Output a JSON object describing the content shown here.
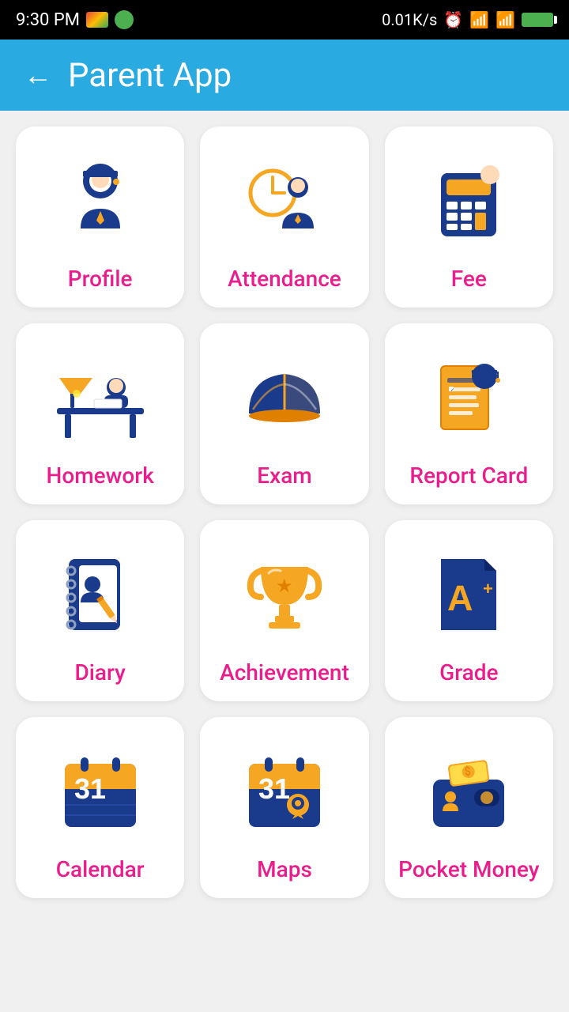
{
  "statusBar": {
    "time": "9:30 PM",
    "network": "0.01K/s"
  },
  "header": {
    "back_label": "←",
    "title": "Parent App"
  },
  "grid": {
    "items": [
      {
        "id": "profile",
        "label": "Profile"
      },
      {
        "id": "attendance",
        "label": "Attendance"
      },
      {
        "id": "fee",
        "label": "Fee"
      },
      {
        "id": "homework",
        "label": "Homework"
      },
      {
        "id": "exam",
        "label": "Exam"
      },
      {
        "id": "report-card",
        "label": "Report Card"
      },
      {
        "id": "diary",
        "label": "Diary"
      },
      {
        "id": "achievement",
        "label": "Achievement"
      },
      {
        "id": "grade",
        "label": "Grade"
      },
      {
        "id": "calendar",
        "label": "Calendar"
      },
      {
        "id": "maps",
        "label": "Maps"
      },
      {
        "id": "pocket-money",
        "label": "Pocket Money"
      }
    ]
  }
}
